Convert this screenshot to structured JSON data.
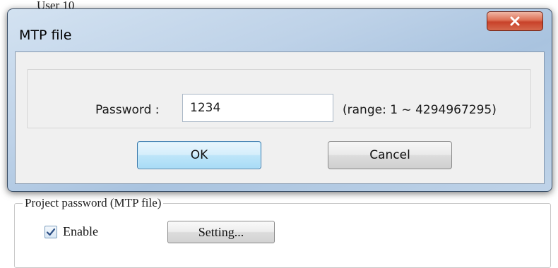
{
  "background": {
    "top_text": "User 10",
    "group_legend": "Project password (MTP file)",
    "enable_label": "Enable",
    "enable_checked": true,
    "setting_button": "Setting..."
  },
  "dialog": {
    "title": "MTP file",
    "close_icon": "close-x-icon",
    "password_label": "Password :",
    "password_value": "1234",
    "range_text": "(range: 1 ~ 4294967295)",
    "ok_label": "OK",
    "cancel_label": "Cancel"
  },
  "colors": {
    "title_bar": "#bed2e8",
    "close_button": "#c8422a",
    "ok_button": "#bde5f9"
  }
}
